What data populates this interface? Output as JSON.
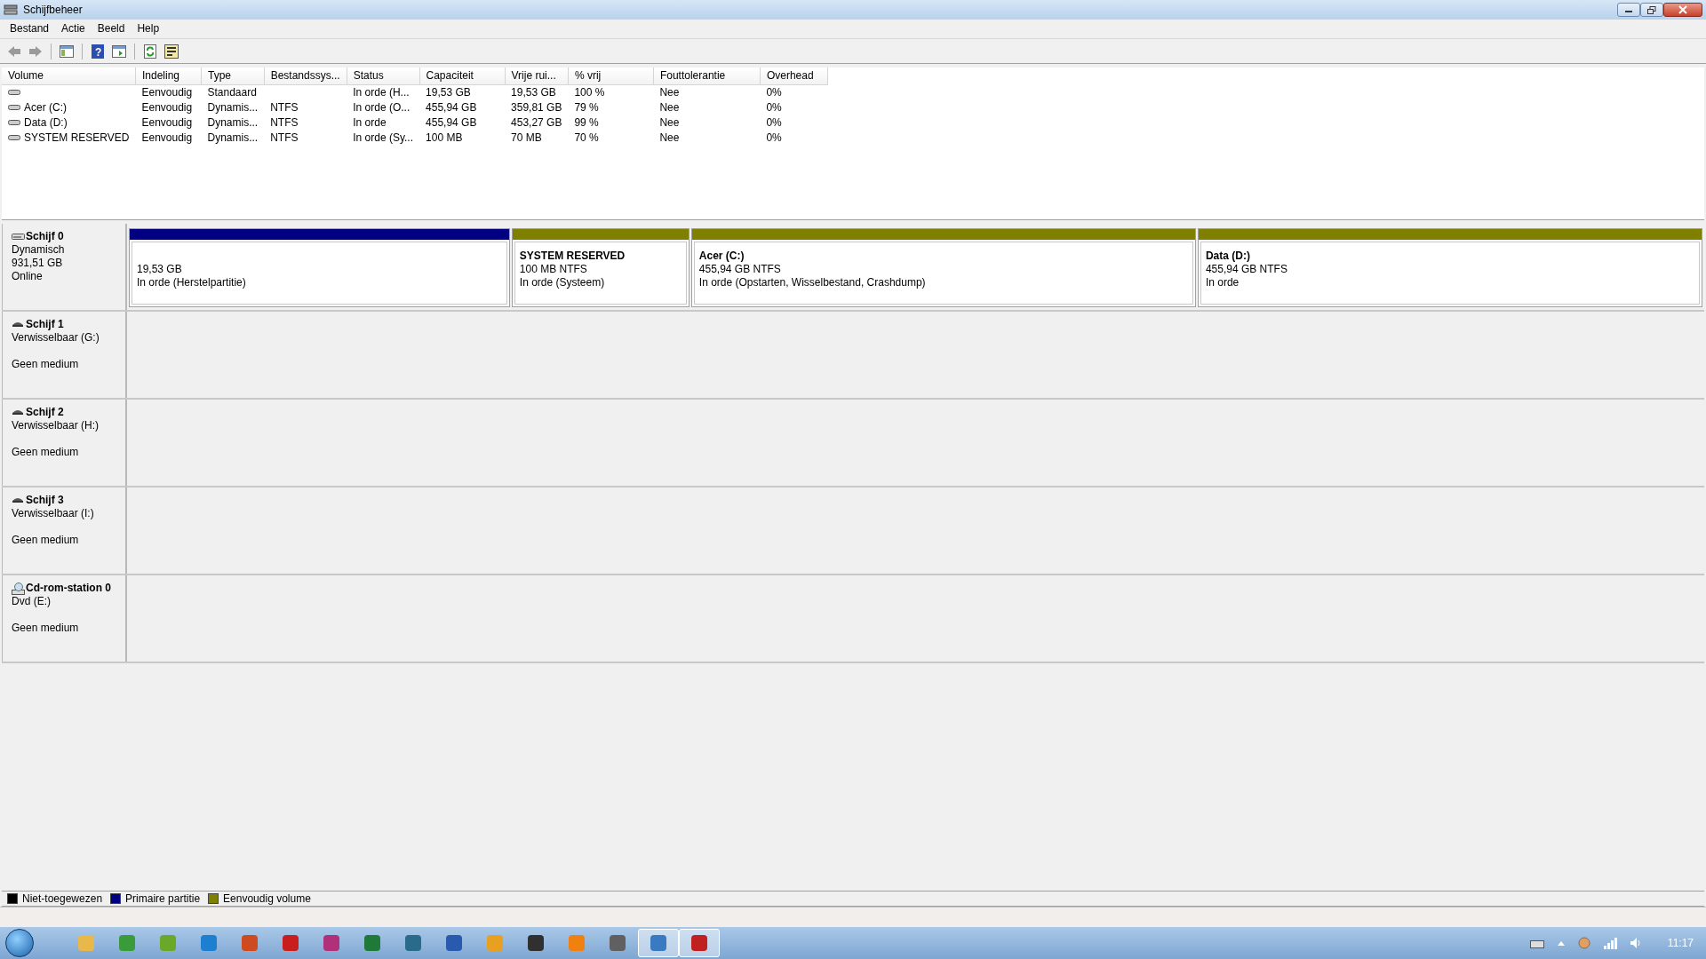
{
  "window": {
    "title": "Schijfbeheer"
  },
  "menu": [
    "Bestand",
    "Actie",
    "Beeld",
    "Help"
  ],
  "toolbar": {
    "help_glyph": "?"
  },
  "table": {
    "columns": [
      "Volume",
      "Indeling",
      "Type",
      "Bestandssys...",
      "Status",
      "Capaciteit",
      "Vrije rui...",
      "% vrij",
      "Fouttolerantie",
      "Overhead"
    ],
    "rows": [
      {
        "cells": [
          "",
          "Eenvoudig",
          "Standaard",
          "",
          "In orde (H...",
          "19,53 GB",
          "19,53 GB",
          "100 %",
          "Nee",
          "0%"
        ]
      },
      {
        "cells": [
          "Acer (C:)",
          "Eenvoudig",
          "Dynamis...",
          "NTFS",
          "In orde (O...",
          "455,94 GB",
          "359,81 GB",
          "79 %",
          "Nee",
          "0%"
        ]
      },
      {
        "cells": [
          "Data (D:)",
          "Eenvoudig",
          "Dynamis...",
          "NTFS",
          "In orde",
          "455,94 GB",
          "453,27 GB",
          "99 %",
          "Nee",
          "0%"
        ]
      },
      {
        "cells": [
          "SYSTEM RESERVED",
          "Eenvoudig",
          "Dynamis...",
          "NTFS",
          "In orde (Sy...",
          "100 MB",
          "70 MB",
          "70 %",
          "Nee",
          "0%"
        ]
      }
    ]
  },
  "disks": [
    {
      "kind": "hdd",
      "name": "Schijf 0",
      "type": "Dynamisch",
      "size": "931,51 GB",
      "status": "Online",
      "partitions": [
        {
          "color": "#000080",
          "size": "19,53 GB",
          "status": "In orde (Herstelpartitie)"
        },
        {
          "color": "#808000",
          "name": "SYSTEM RESERVED",
          "size": "100 MB NTFS",
          "status": "In orde (Systeem)"
        },
        {
          "color": "#808000",
          "name": "Acer  (C:)",
          "size": "455,94 GB NTFS",
          "status": "In orde (Opstarten, Wisselbestand, Crashdump)"
        },
        {
          "color": "#808000",
          "name": "Data  (D:)",
          "size": "455,94 GB NTFS",
          "status": "In orde"
        }
      ]
    },
    {
      "kind": "removable",
      "name": "Schijf 1",
      "type": "Verwisselbaar (G:)",
      "status": "Geen medium"
    },
    {
      "kind": "removable",
      "name": "Schijf 2",
      "type": "Verwisselbaar (H:)",
      "status": "Geen medium"
    },
    {
      "kind": "removable",
      "name": "Schijf 3",
      "type": "Verwisselbaar (I:)",
      "status": "Geen medium"
    },
    {
      "kind": "cdrom",
      "name": "Cd-rom-station 0",
      "type": "Dvd (E:)",
      "status": "Geen medium"
    }
  ],
  "legend": [
    {
      "color": "#000000",
      "label": "Niet-toegewezen"
    },
    {
      "color": "#000080",
      "label": "Primaire partitie"
    },
    {
      "color": "#808000",
      "label": "Eenvoudig volume"
    }
  ],
  "taskbar": {
    "apps": [
      {
        "color": "#e8b84a",
        "active": false
      },
      {
        "color": "#3a9b3a",
        "active": false
      },
      {
        "color": "#6aa82a",
        "active": false
      },
      {
        "color": "#1e7fd0",
        "active": false
      },
      {
        "color": "#d04a20",
        "active": false
      },
      {
        "color": "#c81e1e",
        "active": false
      },
      {
        "color": "#b0307a",
        "active": false
      },
      {
        "color": "#1f7a3a",
        "active": false
      },
      {
        "color": "#2a6a8a",
        "active": false
      },
      {
        "color": "#2a5ab0",
        "active": false
      },
      {
        "color": "#e8a020",
        "active": false
      },
      {
        "color": "#303030",
        "active": false
      },
      {
        "color": "#f08010",
        "active": false
      },
      {
        "color": "#606060",
        "active": false
      },
      {
        "color": "#3a7ac0",
        "active": true
      },
      {
        "color": "#c02020",
        "active": true
      }
    ],
    "clock": "11:17"
  }
}
